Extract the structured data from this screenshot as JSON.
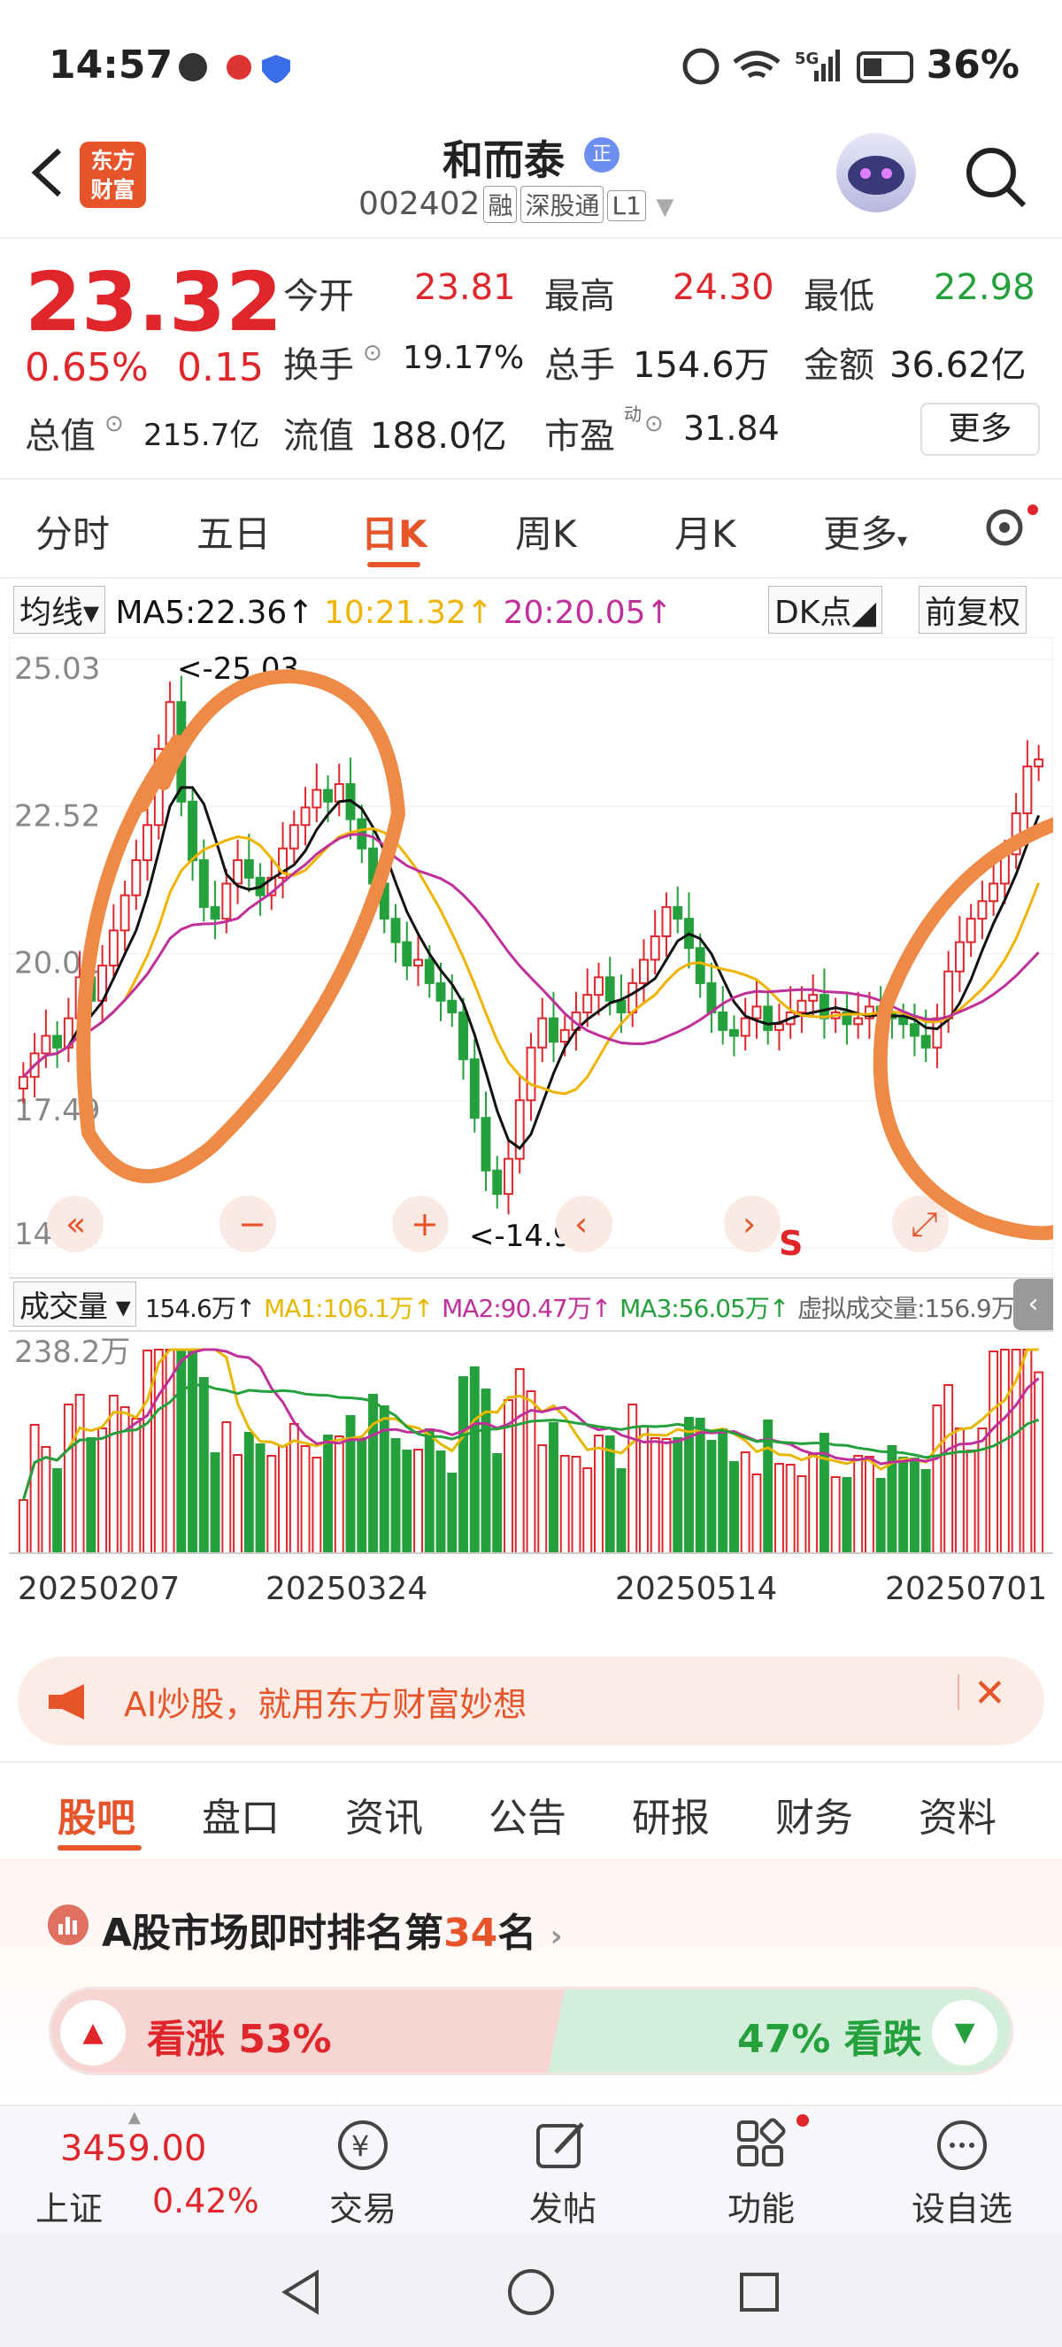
{
  "status_bar": {
    "time": "14:57",
    "network": "5G",
    "battery": "36%"
  },
  "header": {
    "logo_line1": "东方",
    "logo_line2": "财富",
    "stock_name": "和而泰",
    "badge": "正",
    "code": "002402",
    "tags": [
      "融",
      "深股通",
      "L1"
    ]
  },
  "quote": {
    "price": "23.32",
    "change_pct": "0.65%",
    "change": "0.15",
    "open_label": "今开",
    "open": "23.81",
    "high_label": "最高",
    "high": "24.30",
    "low_label": "最低",
    "low": "22.98",
    "turnover_label": "换手",
    "turnover": "19.17%",
    "volume_label": "总手",
    "volume": "154.6万",
    "amount_label": "金额",
    "amount": "36.62亿",
    "mktcap_label": "总值",
    "mktcap": "215.7亿",
    "float_label": "流值",
    "float_cap": "188.0亿",
    "pe_label": "市盈",
    "pe_sup": "动",
    "pe": "31.84",
    "more": "更多"
  },
  "period_tabs": [
    "分时",
    "五日",
    "日K",
    "周K",
    "月K",
    "更多"
  ],
  "ma_row": {
    "dropdown": "均线",
    "ma5": "MA5:22.36↑",
    "ma10": "10:21.32↑",
    "ma20": "20:20.05↑",
    "dk": "DK点",
    "fq": "前复权"
  },
  "chart_data": {
    "type": "candlestick",
    "y_ticks": [
      "25.03",
      "22.52",
      "20.01",
      "17.49",
      "14.98"
    ],
    "max_label": "<-25.03",
    "min_label": "<-14.98",
    "x_labels": [
      "20250207",
      "20250324",
      "20250514",
      "20250701"
    ],
    "close_series": [
      17.9,
      18.3,
      18.6,
      18.4,
      18.9,
      19.6,
      19.2,
      19.8,
      20.4,
      21.0,
      21.6,
      22.2,
      23.5,
      24.3,
      22.6,
      21.6,
      20.8,
      20.6,
      21.2,
      21.6,
      21.3,
      21.0,
      21.3,
      21.8,
      22.2,
      22.5,
      22.8,
      22.6,
      22.9,
      22.3,
      21.8,
      21.2,
      20.6,
      20.2,
      19.8,
      19.9,
      19.5,
      19.2,
      19.0,
      18.2,
      17.2,
      16.3,
      15.9,
      16.5,
      17.5,
      18.4,
      18.9,
      18.5,
      18.7,
      19.0,
      19.3,
      19.6,
      19.2,
      19.0,
      19.5,
      19.9,
      20.3,
      20.8,
      20.6,
      20.1,
      19.5,
      19.0,
      18.7,
      18.6,
      18.9,
      19.1,
      18.7,
      18.8,
      19.0,
      19.2,
      19.3,
      18.9,
      19.0,
      18.8,
      18.9,
      19.1,
      19.0,
      18.9,
      18.8,
      18.6,
      18.4,
      18.9,
      19.7,
      20.2,
      20.6,
      20.9,
      21.2,
      21.7,
      22.4,
      23.2,
      23.32
    ],
    "ma5_now": 22.36,
    "ma10_now": 21.32,
    "ma20_now": 20.05
  },
  "volume": {
    "dropdown": "成交量",
    "vol": "154.6万↑",
    "ma1": "MA1:106.1万↑",
    "ma2": "MA2:90.47万↑",
    "ma3": "MA3:56.05万↑",
    "virtual": "虚拟成交量:156.9万",
    "max_label": "238.2万"
  },
  "ai_banner": {
    "text": "AI炒股，就用东方财富妙想"
  },
  "section_tabs": [
    "股吧",
    "盘口",
    "资讯",
    "公告",
    "研报",
    "财务",
    "资料"
  ],
  "ranking": {
    "prefix": "A股市场即时排名第",
    "rank": "34",
    "suffix": "名"
  },
  "sentiment": {
    "bull_label": "看涨 53%",
    "bear_label": "47% 看跌"
  },
  "bottom_bar": {
    "index_value": "3459.00",
    "index_name": "上证",
    "index_change": "0.42%",
    "items": [
      "交易",
      "发帖",
      "功能",
      "设自选"
    ]
  },
  "colors": {
    "up": "#e0252b",
    "down": "#24a03c",
    "accent": "#e8542a",
    "ma5": "#111111",
    "ma10": "#f0b400",
    "ma20": "#c0309a"
  }
}
